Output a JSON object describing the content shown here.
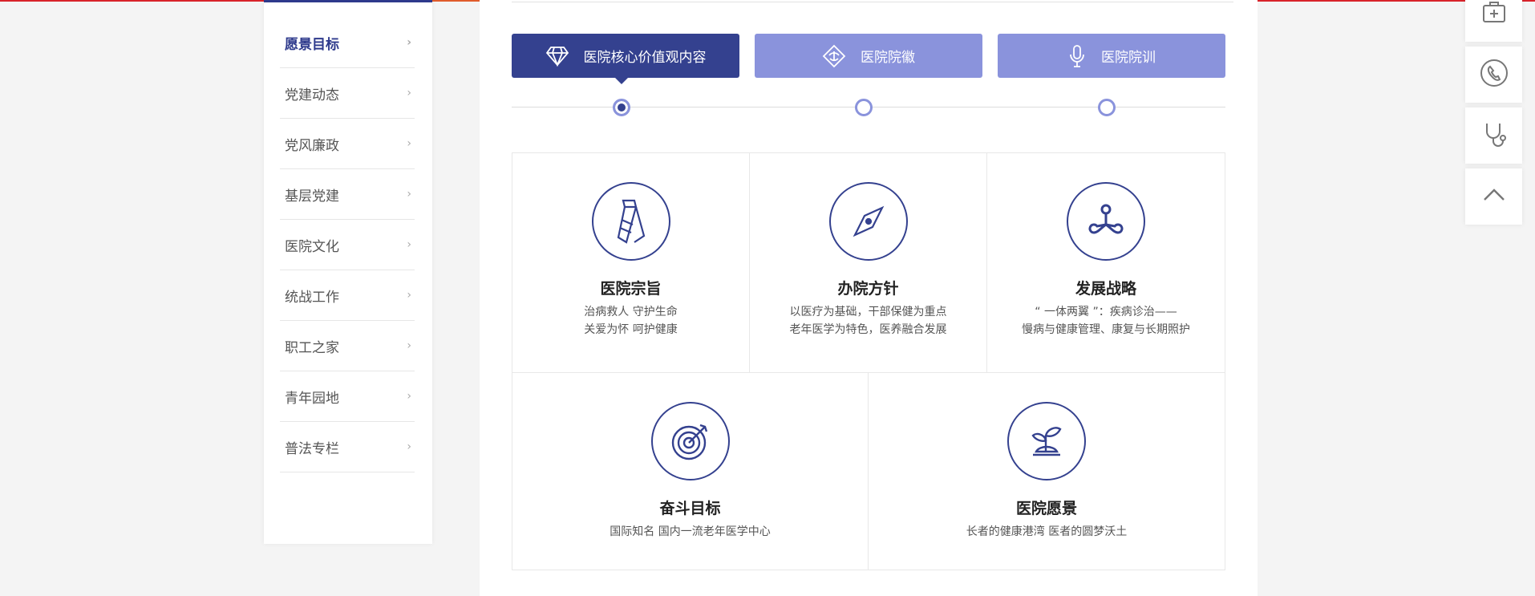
{
  "sidebar": {
    "items": [
      {
        "label": "愿景目标",
        "active": true
      },
      {
        "label": "党建动态"
      },
      {
        "label": "党风廉政"
      },
      {
        "label": "基层党建"
      },
      {
        "label": "医院文化"
      },
      {
        "label": "统战工作"
      },
      {
        "label": "职工之家"
      },
      {
        "label": "青年园地"
      },
      {
        "label": "普法专栏"
      }
    ],
    "arrow": "›"
  },
  "tabs": [
    {
      "label": "医院核心价值观内容",
      "icon": "diamond-icon",
      "active": true
    },
    {
      "label": "医院院徽",
      "icon": "hospital-emblem-icon"
    },
    {
      "label": "医院院训",
      "icon": "microphone-icon"
    }
  ],
  "cards": [
    {
      "title": "医院宗旨",
      "lines": [
        "治病救人 守护生命",
        "关爱为怀 呵护健康"
      ],
      "icon": "tie-icon"
    },
    {
      "title": "办院方针",
      "lines": [
        "以医疗为基础，干部保健为重点",
        "老年医学为特色，医养融合发展"
      ],
      "icon": "compass-icon"
    },
    {
      "title": "发展战略",
      "lines": [
        "“ 一体两翼 ”：疾病诊治——",
        "慢病与健康管理、康复与长期照护"
      ],
      "icon": "strategy-icon"
    },
    {
      "title": "奋斗目标",
      "lines": [
        "国际知名 国内一流老年医学中心"
      ],
      "icon": "target-icon"
    },
    {
      "title": "医院愿景",
      "lines": [
        "长者的健康港湾 医者的圆梦沃土"
      ],
      "icon": "sprout-icon"
    }
  ],
  "float_buttons": [
    "medical-kit-icon",
    "phone-icon",
    "stethoscope-icon",
    "back-to-top-icon"
  ],
  "colors": {
    "primary": "#34418f",
    "light": "#8a93dc",
    "accent": "#d8232a"
  }
}
